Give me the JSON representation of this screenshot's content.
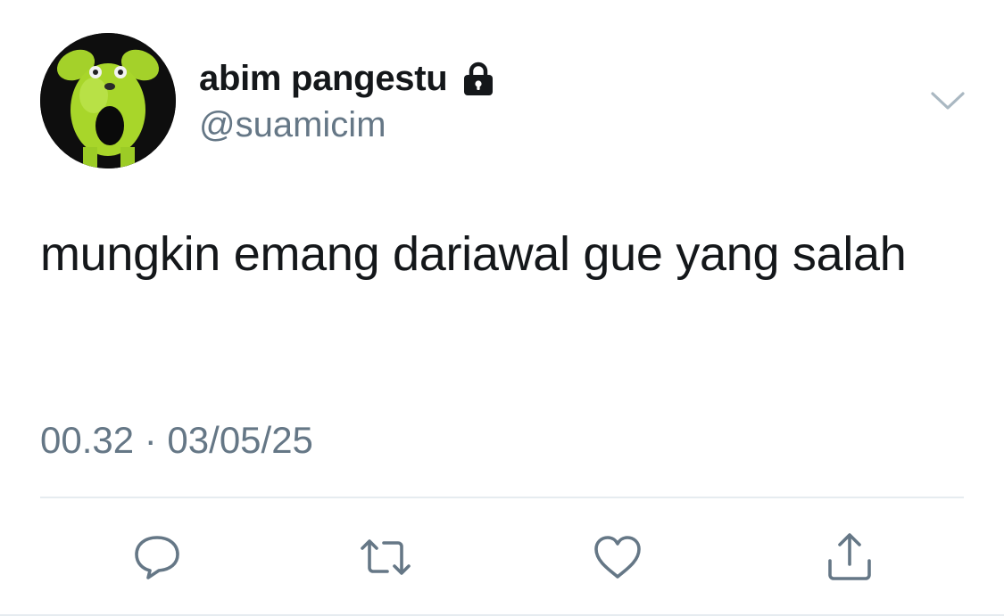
{
  "user": {
    "display_name": "abim pangestu",
    "handle": "@suamicim",
    "avatar_icon": "green-monster-avatar",
    "protected_icon": "lock-icon"
  },
  "tweet": {
    "text": "mungkin emang dariawal gue yang salah",
    "timestamp": "00.32 · 03/05/25"
  },
  "actions": {
    "icons": [
      "reply-icon",
      "retweet-icon",
      "like-icon",
      "share-icon"
    ]
  },
  "colors": {
    "text_primary": "#14171a",
    "text_secondary": "#657786",
    "icon": "#657786",
    "divider": "#e6ecf0",
    "avatar_green": "#a8d62a"
  }
}
